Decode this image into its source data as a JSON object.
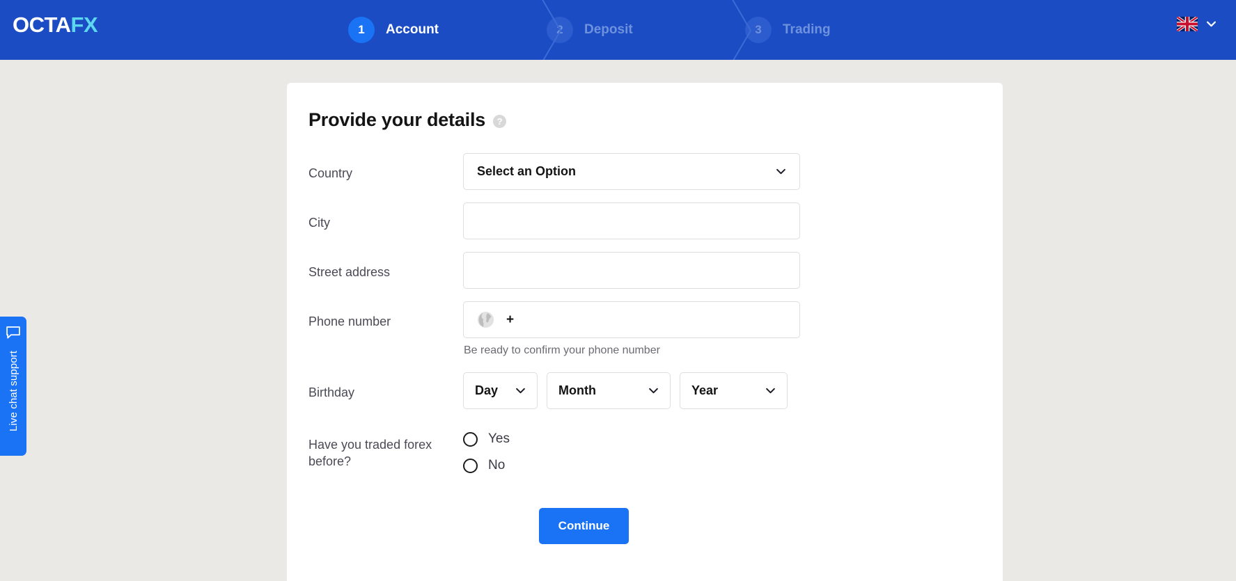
{
  "brand": {
    "logo_primary": "OCTA",
    "logo_accent": "FX",
    "header_color": "#1B4CC4",
    "accent_color": "#1A73F5",
    "logo_accent_color": "#5DD6F0",
    "page_background": "#EBE9E5"
  },
  "steps": [
    {
      "number": "1",
      "label": "Account",
      "state": "active"
    },
    {
      "number": "2",
      "label": "Deposit",
      "state": "inactive"
    },
    {
      "number": "3",
      "label": "Trading",
      "state": "inactive"
    }
  ],
  "language": {
    "flag": "uk-flag-icon",
    "chevron": "chevron-down-icon"
  },
  "card": {
    "title": "Provide your details",
    "help_icon_glyph": "?"
  },
  "form": {
    "country": {
      "label": "Country",
      "value": "Select an Option",
      "placeholder": "Select an Option"
    },
    "city": {
      "label": "City",
      "value": "",
      "placeholder": ""
    },
    "street": {
      "label": "Street address",
      "value": "",
      "placeholder": ""
    },
    "phone": {
      "label": "Phone number",
      "prefix": "+",
      "value": "",
      "placeholder": "",
      "hint": "Be ready to confirm your phone number"
    },
    "birthday": {
      "label": "Birthday",
      "day": "Day",
      "month": "Month",
      "year": "Year"
    },
    "traded_forex": {
      "label": "Have you traded forex before?",
      "options": [
        {
          "label": "Yes",
          "selected": false
        },
        {
          "label": "No",
          "selected": false
        }
      ]
    },
    "submit_label": "Continue"
  },
  "chat_widget": {
    "label": "Live chat support"
  }
}
